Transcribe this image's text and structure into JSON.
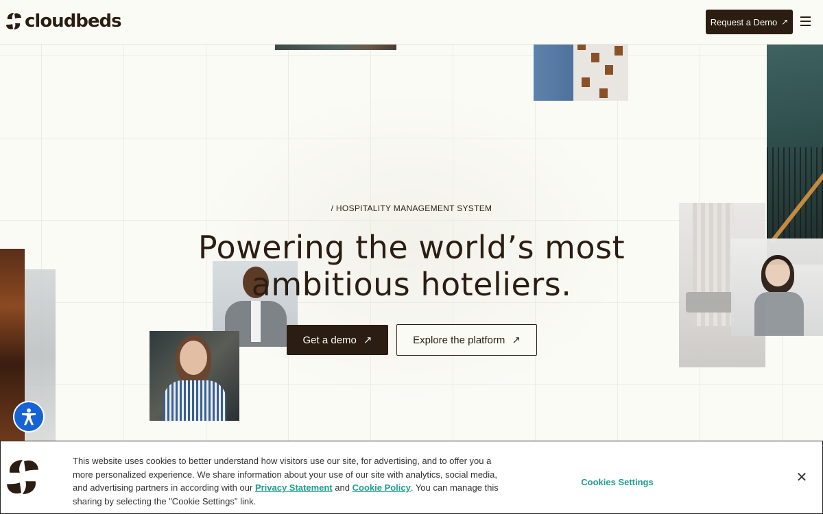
{
  "header": {
    "logo_text": "cloudbeds",
    "request_demo_label": "Request a Demo",
    "request_demo_arrow": "↗"
  },
  "hero": {
    "eyebrow": "/ HOSPITALITY MANAGEMENT SYSTEM",
    "title_line1": "Powering the world’s most",
    "title_line2": "ambitious hoteliers.",
    "primary_cta": "Get a demo",
    "secondary_cta": "Explore the platform",
    "cta_arrow": "↗"
  },
  "cookie_banner": {
    "text_before": "This website uses cookies to better understand how visitors use our site, for advertising, and to offer you a more personalized experience. We share information about your use of our site with analytics, social media, and advertising partners in according with our ",
    "privacy_link": "Privacy Statement",
    "text_and": " and ",
    "cookie_link": "Cookie Policy",
    "text_after": ". You can manage this sharing by selecting the \"Cookie Settings\" link.",
    "settings_label": "Cookies Settings",
    "close_label": "✕"
  },
  "colors": {
    "background": "#fbfbf6",
    "brand_dark": "#2b1d12",
    "link_teal": "#1f9e8f",
    "accessibility_blue": "#1663d6"
  },
  "icons": {
    "menu": "hamburger-menu-icon",
    "accessibility": "accessibility-icon",
    "close": "close-icon",
    "arrow": "arrow-up-right-icon"
  }
}
